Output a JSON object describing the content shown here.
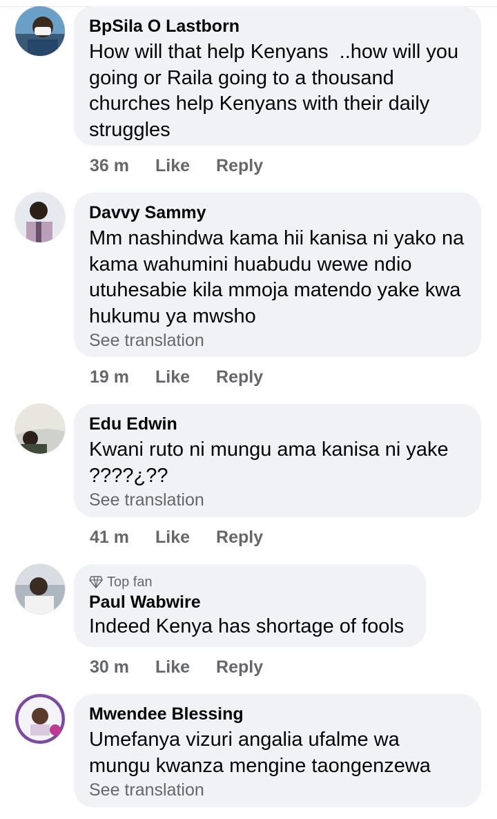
{
  "comments": [
    {
      "author": "BpSila O Lastborn",
      "text": "How will that help Kenyans  ..how will you going or Raila going to a thousand churches help Kenyans with their daily struggles",
      "time": "36 m",
      "like": "Like",
      "reply": "Reply"
    },
    {
      "author": "Davvy Sammy",
      "text": "Mm nashindwa kama hii kanisa ni yako na kama wahumini huabudu wewe ndio utuhesabie kila mmoja matendo yake kwa hukumu ya mwsho",
      "translate": "See translation",
      "time": "19 m",
      "like": "Like",
      "reply": "Reply"
    },
    {
      "author": "Edu Edwin",
      "text": "Kwani ruto ni mungu ama kanisa ni yake ????¿??",
      "translate": "See translation",
      "time": "41 m",
      "like": "Like",
      "reply": "Reply"
    },
    {
      "badge": "Top fan",
      "author": "Paul Wabwire",
      "text": "Indeed Kenya has shortage of fools",
      "time": "30 m",
      "like": "Like",
      "reply": "Reply"
    },
    {
      "author": "Mwendee Blessing",
      "text": "Umefanya vizuri angalia ufalme wa mungu kwanza mengine taongenzewa",
      "translate": "See translation"
    }
  ],
  "colors": {
    "bubble": "#f0f2f5",
    "secondary_text": "#65676b",
    "primary_text": "#050505"
  },
  "icons": [
    "diamond-icon",
    "avatar-photo"
  ]
}
